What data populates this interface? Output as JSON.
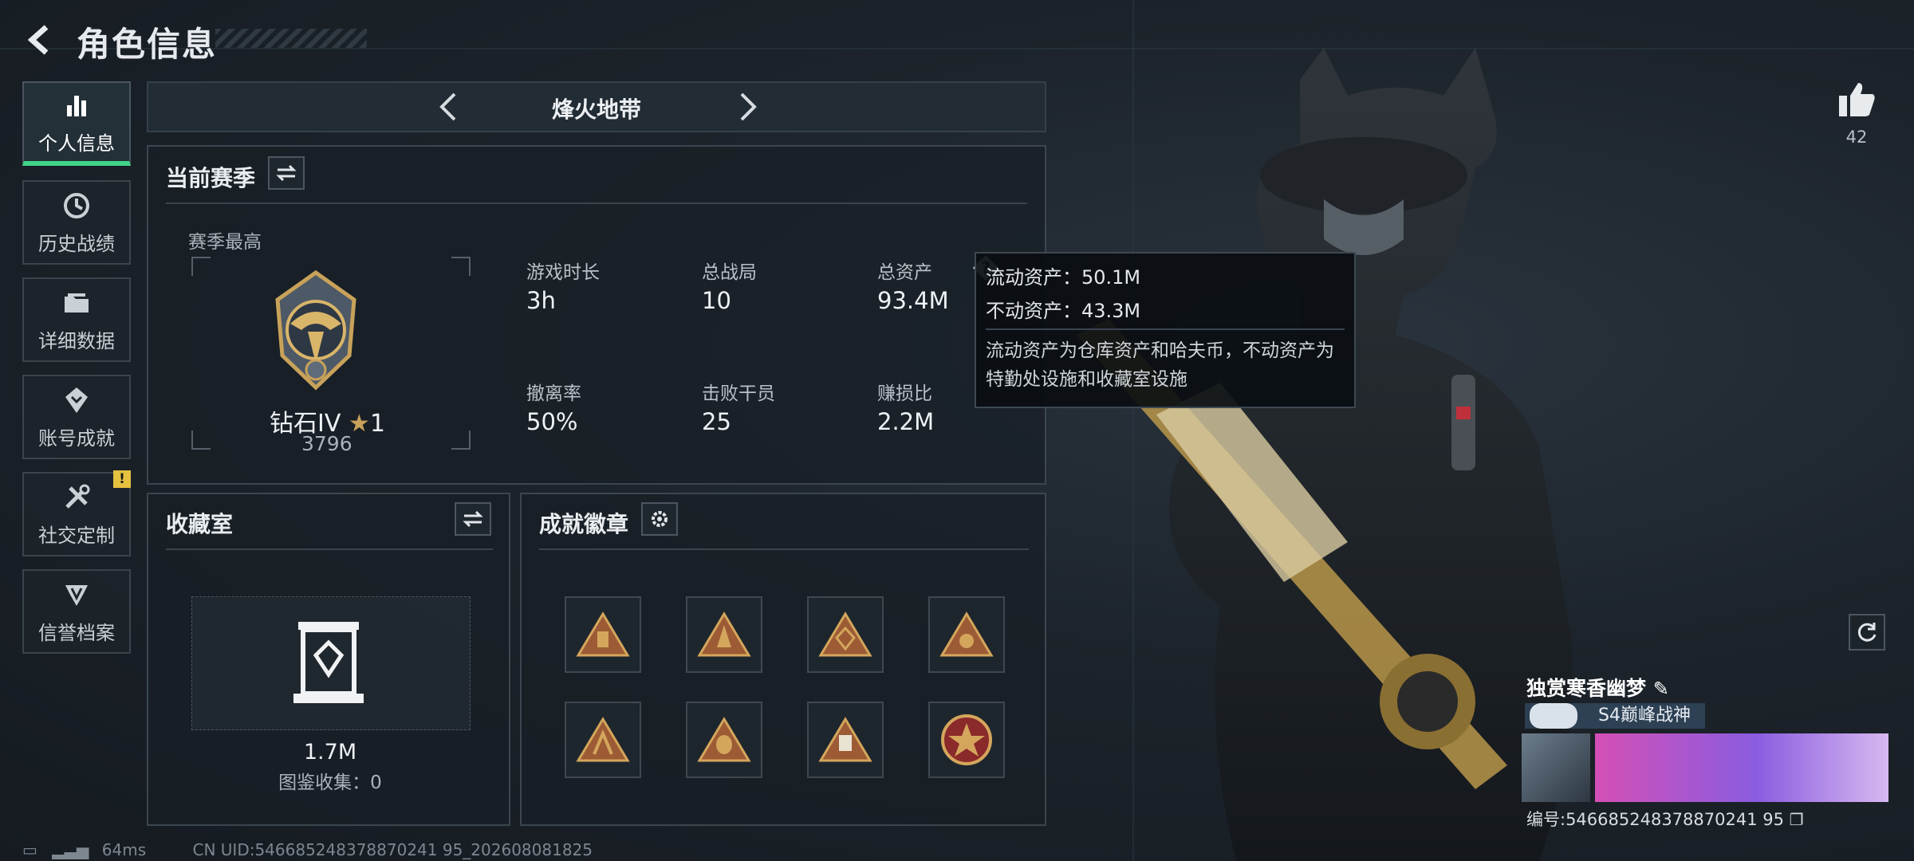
{
  "header": {
    "title": "角色信息"
  },
  "nav": {
    "items": [
      {
        "label": "个人信息",
        "icon": "bar-chart-icon",
        "active": true
      },
      {
        "label": "历史战绩",
        "icon": "history-icon"
      },
      {
        "label": "详细数据",
        "icon": "folder-icon"
      },
      {
        "label": "账号成就",
        "icon": "achievement-icon"
      },
      {
        "label": "社交定制",
        "icon": "tools-icon",
        "alert": "!"
      },
      {
        "label": "信誉档案",
        "icon": "reputation-icon"
      }
    ]
  },
  "mode": {
    "title": "烽火地带"
  },
  "season": {
    "title": "当前赛季",
    "highest_label": "赛季最高",
    "rank_name": "钻石IV",
    "rank_stars": "1",
    "rank_score": "3796",
    "stats": [
      {
        "label": "游戏时长",
        "value": "3h"
      },
      {
        "label": "总战局",
        "value": "10"
      },
      {
        "label": "总资产",
        "value": "93.4M"
      },
      {
        "label": "撤离率",
        "value": "50%"
      },
      {
        "label": "击败干员",
        "value": "25"
      },
      {
        "label": "赚损比",
        "value": "2.2M"
      }
    ]
  },
  "tooltip": {
    "liquid": "流动资产：50.1M",
    "fixed": "不动资产：43.3M",
    "desc": "流动资产为仓库资产和哈夫币，不动资产为特勤处设施和收藏室设施"
  },
  "collection": {
    "title": "收藏室",
    "value": "1.7M",
    "gallery": "图鉴收集：0"
  },
  "achievements": {
    "title": "成就徽章"
  },
  "right": {
    "likes": "42",
    "player_name": "独赏寒香幽梦",
    "tag": "S4巅峰战神",
    "player_id": "编号:546685248378870241 95"
  },
  "status": {
    "ping": "64ms",
    "uid": "CN UID:546685248378870241 95_202608081825"
  },
  "colors": {
    "accent": "#3fd58a",
    "gold": "#c8a25a",
    "alert": "#e6c140"
  }
}
